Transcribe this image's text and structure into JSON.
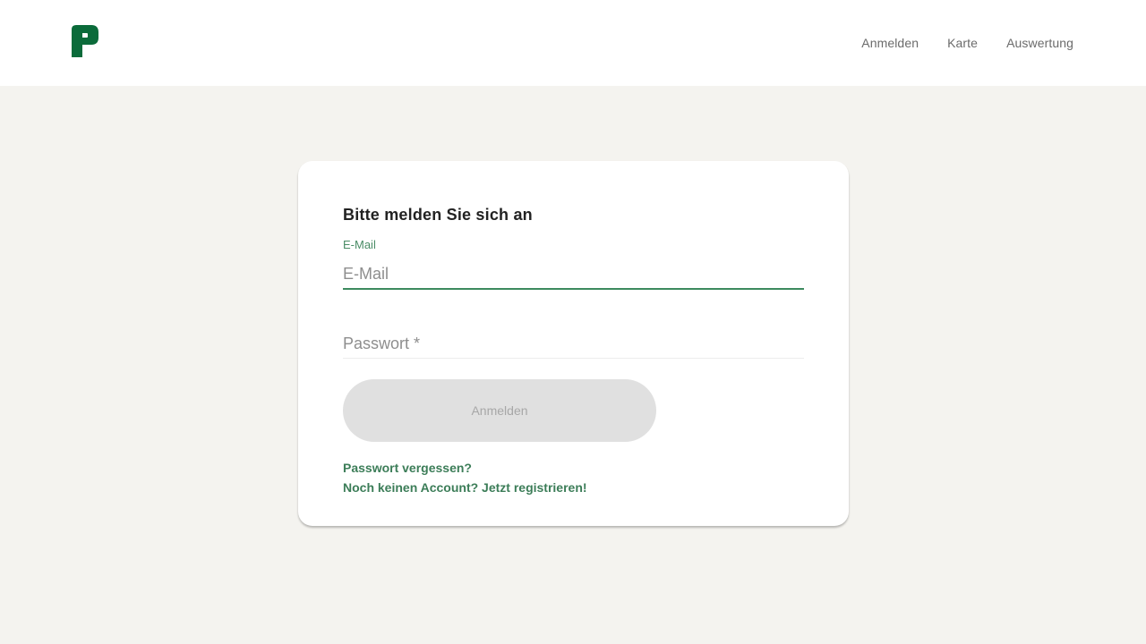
{
  "header": {
    "logo": "leaf-logo-icon",
    "nav": [
      {
        "label": "Anmelden"
      },
      {
        "label": "Karte"
      },
      {
        "label": "Auswertung"
      }
    ]
  },
  "login": {
    "title": "Bitte melden Sie sich an",
    "email": {
      "label": "E-Mail",
      "placeholder": "E-Mail",
      "value": ""
    },
    "password": {
      "placeholder": "Passwort *",
      "value": ""
    },
    "submit_label": "Anmelden",
    "forgot_link": "Passwort vergessen?",
    "register_link": "Noch keinen Account? Jetzt registrieren!"
  },
  "colors": {
    "brand_green": "#0b6b3a",
    "link_green": "#3c7d58",
    "focus_underline": "#3c8a5e",
    "page_bg": "#f4f3ef"
  }
}
